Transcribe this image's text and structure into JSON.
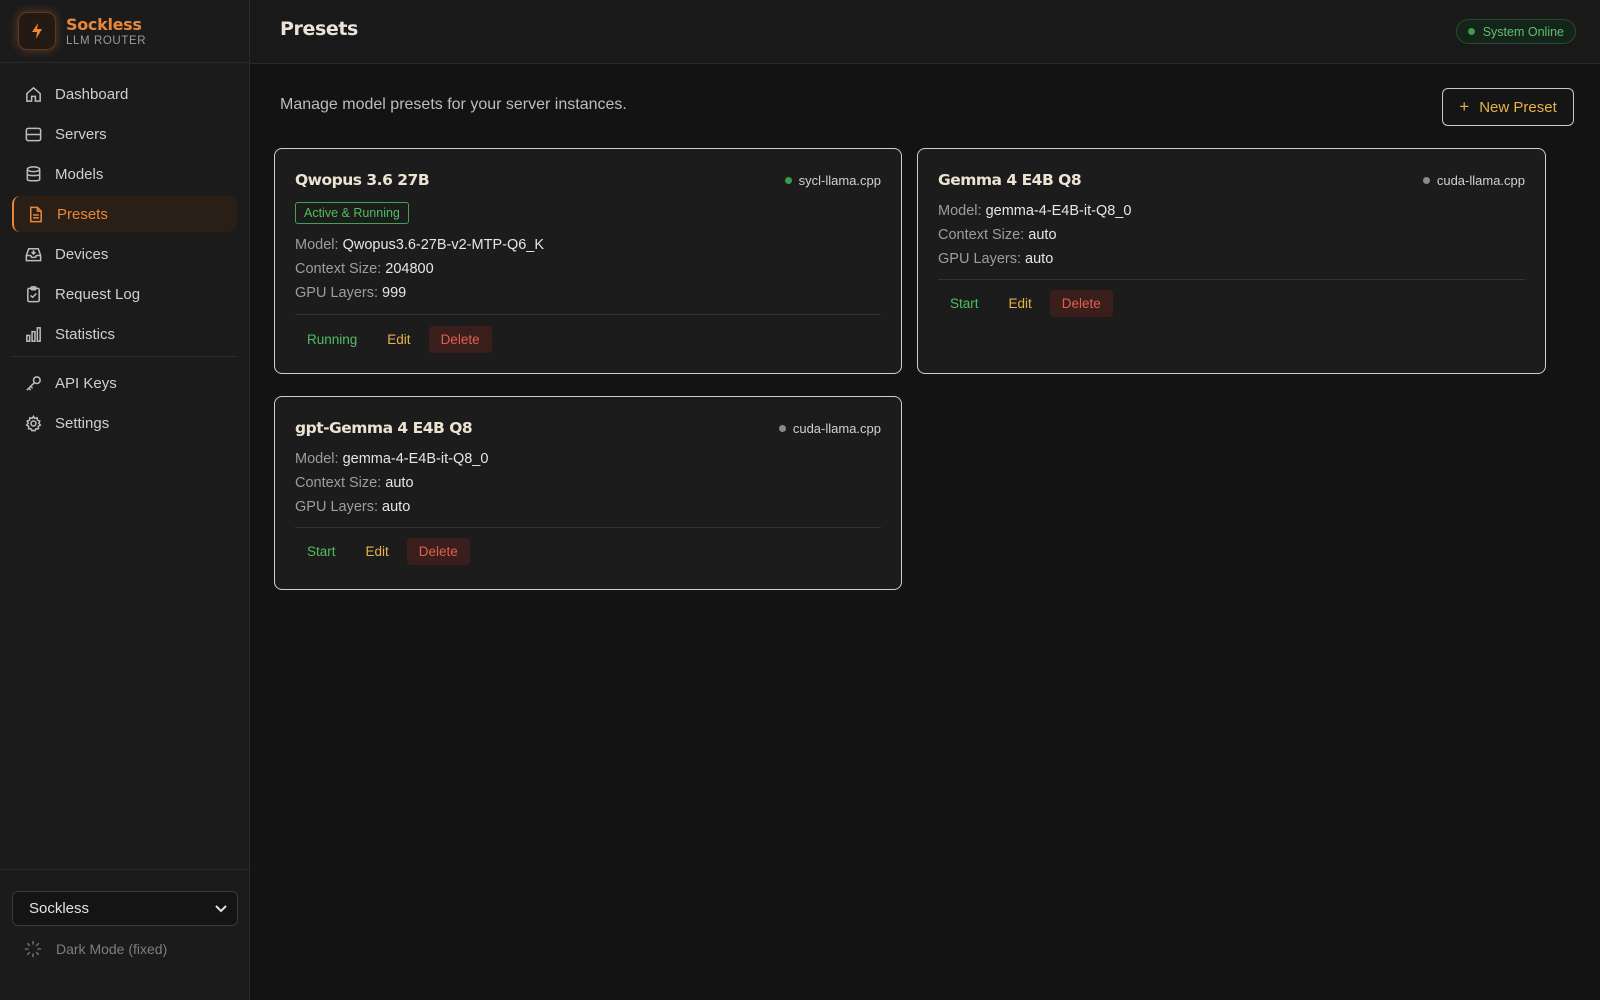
{
  "brand": {
    "name": "Sockless",
    "subtitle": "LLM ROUTER"
  },
  "nav": {
    "items": [
      {
        "label": "Dashboard",
        "icon": "home-icon"
      },
      {
        "label": "Servers",
        "icon": "server-icon"
      },
      {
        "label": "Models",
        "icon": "database-icon"
      },
      {
        "label": "Presets",
        "icon": "file-icon",
        "active": true
      },
      {
        "label": "Devices",
        "icon": "inbox-icon"
      },
      {
        "label": "Request Log",
        "icon": "clipboard-icon"
      },
      {
        "label": "Statistics",
        "icon": "bar-chart-icon"
      }
    ],
    "secondary": [
      {
        "label": "API Keys",
        "icon": "key-icon"
      },
      {
        "label": "Settings",
        "icon": "gear-icon"
      }
    ]
  },
  "footer": {
    "instance": "Sockless",
    "dark_mode": "Dark Mode (fixed)"
  },
  "header": {
    "title": "Presets",
    "status": "System Online"
  },
  "main": {
    "subtitle": "Manage model presets for your server instances.",
    "new_preset": "New Preset"
  },
  "labels": {
    "model": "Model:",
    "context": "Context Size:",
    "gpu": "GPU Layers:"
  },
  "presets": [
    {
      "name": "Qwopus 3.6 27B",
      "engine": "sycl-llama.cpp",
      "engine_status_color": "#3c9a4d",
      "badge": "Active & Running",
      "model": "Qwopus3.6-27B-v2-MTP-Q6_K",
      "context": "204800",
      "gpu_layers": "999",
      "primary_action": "Running",
      "edit": "Edit",
      "delete": "Delete"
    },
    {
      "name": "Gemma 4 E4B Q8",
      "engine": "cuda-llama.cpp",
      "engine_status_color": "#8a8a8a",
      "model": "gemma-4-E4B-it-Q8_0",
      "context": "auto",
      "gpu_layers": "auto",
      "primary_action": "Start",
      "edit": "Edit",
      "delete": "Delete"
    },
    {
      "name": "gpt-Gemma 4 E4B Q8",
      "engine": "cuda-llama.cpp",
      "engine_status_color": "#8a8a8a",
      "model": "gemma-4-E4B-it-Q8_0",
      "context": "auto",
      "gpu_layers": "auto",
      "primary_action": "Start",
      "edit": "Edit",
      "delete": "Delete"
    }
  ],
  "colors": {
    "accent": "#e8873a",
    "success": "#4fbe60",
    "warning": "#e6b24a",
    "danger": "#e2604e"
  }
}
